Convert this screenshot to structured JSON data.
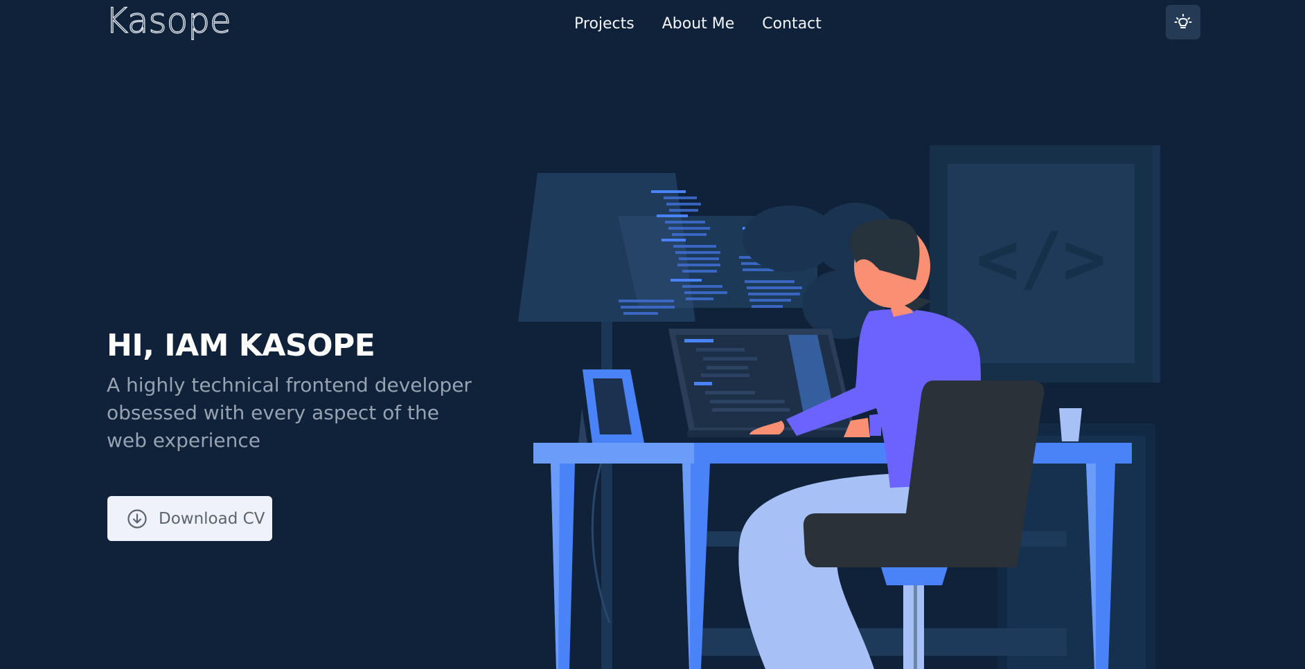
{
  "header": {
    "logo": "Kasope",
    "nav": [
      {
        "label": "Projects"
      },
      {
        "label": "About Me"
      },
      {
        "label": "Contact"
      }
    ],
    "theme_toggle_icon": "lightbulb-icon"
  },
  "hero": {
    "title": "HI, IAM KASOPE",
    "subtitle": "A highly technical frontend developer obsessed with every aspect of the web experience",
    "cta_label": "Download CV",
    "cta_icon": "download-circle-icon",
    "illustration_code_tag": "</>"
  },
  "colors": {
    "background": "#0f2239",
    "accent_blue": "#4a82f7",
    "shirt_purple": "#6c63ff",
    "button_bg": "#eff2fa"
  }
}
